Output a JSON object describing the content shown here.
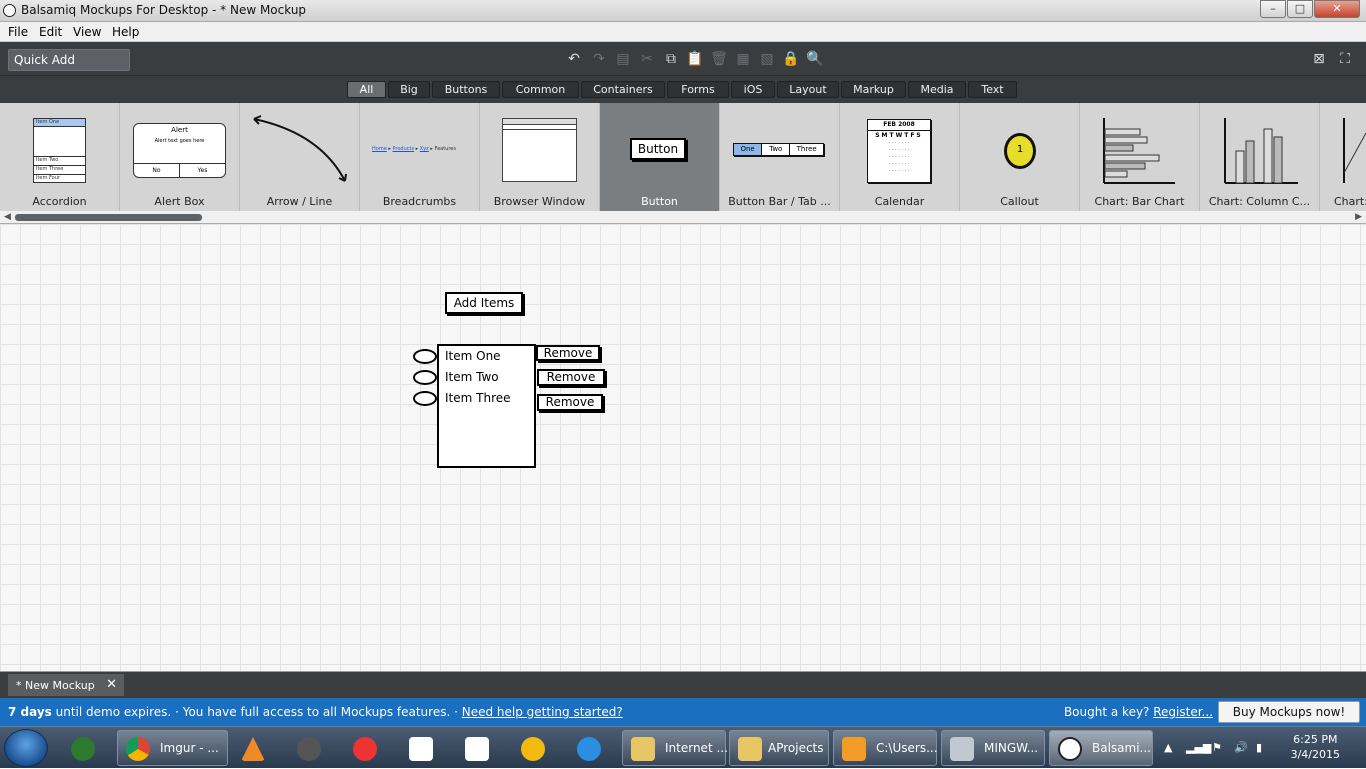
{
  "window": {
    "title": "Balsamiq Mockups For Desktop - * New Mockup",
    "minimize": "–",
    "maximize": "□",
    "close": "✕"
  },
  "menu": [
    "File",
    "Edit",
    "View",
    "Help"
  ],
  "toolbar": {
    "quick_add_placeholder": "Quick Add"
  },
  "tabs": [
    {
      "label": "All",
      "active": true
    },
    {
      "label": "Big"
    },
    {
      "label": "Buttons"
    },
    {
      "label": "Common"
    },
    {
      "label": "Containers"
    },
    {
      "label": "Forms"
    },
    {
      "label": "iOS"
    },
    {
      "label": "Layout"
    },
    {
      "label": "Markup"
    },
    {
      "label": "Media"
    },
    {
      "label": "Text"
    }
  ],
  "library": [
    {
      "label": "Accordion",
      "thumb_items": [
        "Item One",
        "Item Two",
        "Item Three",
        "Item Four"
      ]
    },
    {
      "label": "Alert Box",
      "thumb_title": "Alert",
      "thumb_text": "Alert text goes here",
      "thumb_buttons": [
        "No",
        "Yes"
      ]
    },
    {
      "label": "Arrow / Line"
    },
    {
      "label": "Breadcrumbs",
      "thumb_crumbs": [
        "Home",
        "Products",
        "Xyz",
        "Features"
      ]
    },
    {
      "label": "Browser Window"
    },
    {
      "label": "Button",
      "thumb_text": "Button",
      "selected": true
    },
    {
      "label": "Button Bar / Tab ...",
      "thumb_buttons": [
        "One",
        "Two",
        "Three"
      ]
    },
    {
      "label": "Calendar",
      "thumb_header": "FEB 2008",
      "thumb_days": "SMTWTFS"
    },
    {
      "label": "Callout",
      "thumb_text": "1"
    },
    {
      "label": "Chart: Bar Chart"
    },
    {
      "label": "Chart: Column C..."
    },
    {
      "label": "Chart:"
    }
  ],
  "canvas": {
    "add_button": "Add Items",
    "list_items": [
      "Item One",
      "Item Two",
      "Item Three"
    ],
    "remove_label": "Remove"
  },
  "document_tab": {
    "label": "* New Mockup",
    "close": "✕"
  },
  "status": {
    "days": "7 days",
    "demo_text": "until demo expires.",
    "access_text": "You have full access to all Mockups features.",
    "help_link": "Need help getting started?",
    "bought_text": "Bought a key?",
    "register_link": "Register...",
    "buy_button": "Buy Mockups now!"
  },
  "taskbar": {
    "items": [
      {
        "label": "Imgur - ...",
        "icon": "chrome-icon",
        "color": "#2e9a47"
      },
      {
        "label": "Internet ...",
        "icon": "folder-icon",
        "color": "#e8c565"
      },
      {
        "label": "AProjects",
        "icon": "folder-icon",
        "color": "#e8c565"
      },
      {
        "label": "C:\\Users...",
        "icon": "sublime-icon",
        "color": "#f29b27"
      },
      {
        "label": "MINGW...",
        "icon": "terminal-icon",
        "color": "#c0c8d0"
      },
      {
        "label": "Balsami...",
        "icon": "balsamiq-icon",
        "color": "#ffffff"
      }
    ],
    "time": "6:25 PM",
    "date": "3/4/2015"
  }
}
